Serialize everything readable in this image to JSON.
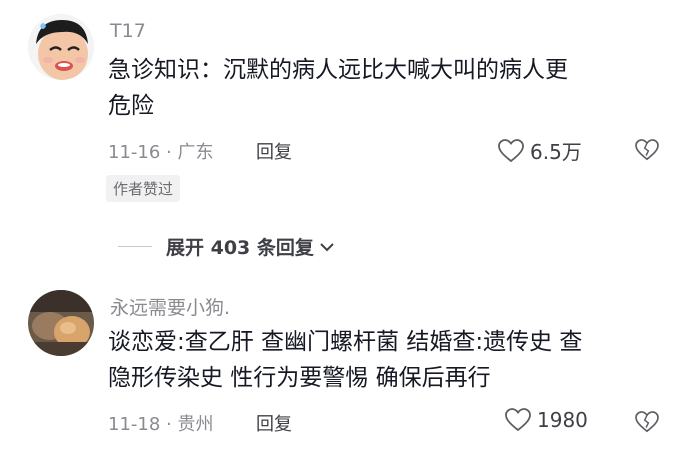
{
  "comments": [
    {
      "username": "T17",
      "text_line1": "急诊知识：沉默的病人远比大喊大叫的病人更",
      "text_line2": "危险",
      "date_location": "11-16 · 广东",
      "reply_label": "回复",
      "likes": "6.5万",
      "badge": "作者赞过"
    },
    {
      "username": "永远需要小狗.",
      "text_line1": "谈恋爱:查乙肝 查幽门螺杆菌 结婚查:遗传史 查",
      "text_line2": "隐形传染史 性行为要警惕 确保后再行",
      "date_location": "11-18 · 贵州",
      "reply_label": "回复",
      "likes": "1980"
    }
  ],
  "expand_replies": {
    "label": "展开 403 条回复"
  },
  "icons": {
    "like": "heart-outline-icon",
    "dislike": "broken-heart-icon",
    "expand": "chevron-down-icon"
  }
}
